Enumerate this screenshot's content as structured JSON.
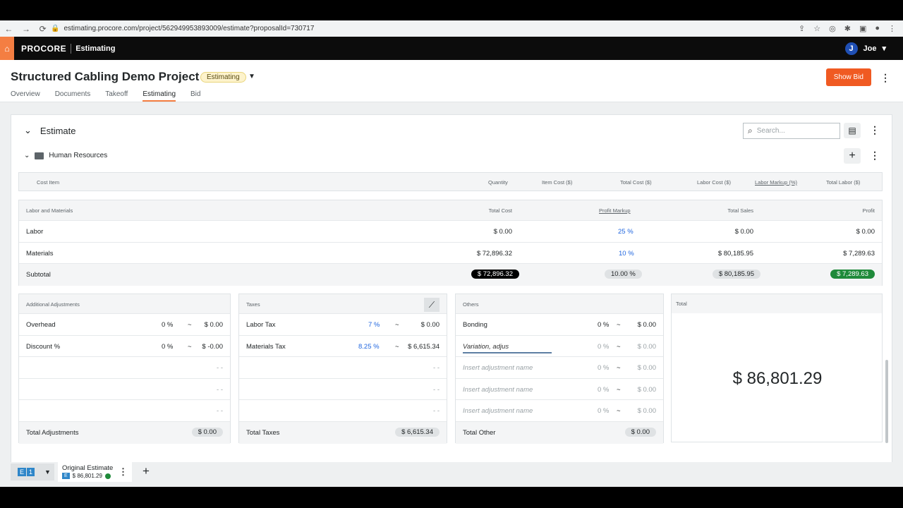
{
  "browser": {
    "url": "estimating.procore.com/project/562949953893009/estimate?proposalId=730717"
  },
  "appbar": {
    "logo": "PROCORE",
    "app_name": "Estimating",
    "user_initial": "J",
    "user_name": "Joe"
  },
  "project": {
    "title": "Structured Cabling Demo Project",
    "status": "Estimating",
    "show_bid": "Show Bid",
    "tabs": [
      "Overview",
      "Documents",
      "Takeoff",
      "Estimating",
      "Bid"
    ],
    "active_tab": "Estimating"
  },
  "estimate": {
    "title": "Estimate",
    "search_placeholder": "Search...",
    "group_name": "Human Resources",
    "cost_columns": [
      "Cost Item",
      "Quantity",
      "Item Cost ($)",
      "Total Cost ($)",
      "Labor Cost ($)",
      "Labor Markup (%)",
      "Total Labor ($)"
    ]
  },
  "labor_materials": {
    "headers": [
      "Labor and Materials",
      "Total Cost",
      "Profit Markup",
      "Total Sales",
      "Profit"
    ],
    "rows": [
      {
        "name": "Labor",
        "total_cost": "$ 0.00",
        "markup": "25 %",
        "total_sales": "$ 0.00",
        "profit": "$ 0.00"
      },
      {
        "name": "Materials",
        "total_cost": "$ 72,896.32",
        "markup": "10 %",
        "total_sales": "$ 80,185.95",
        "profit": "$ 7,289.63"
      }
    ],
    "subtotal": {
      "name": "Subtotal",
      "total_cost": "$ 72,896.32",
      "markup": "10.00 %",
      "total_sales": "$ 80,185.95",
      "profit": "$ 7,289.63"
    }
  },
  "adjustments": {
    "title": "Additional Adjustments",
    "rows": [
      {
        "name": "Overhead",
        "pct": "0 %",
        "sep": "~",
        "value": "$ 0.00"
      },
      {
        "name": "Discount %",
        "pct": "0 %",
        "sep": "~",
        "value": "$ -0.00"
      }
    ],
    "empty": "- -",
    "total_label": "Total Adjustments",
    "total": "$ 0.00"
  },
  "taxes": {
    "title": "Taxes",
    "rows": [
      {
        "name": "Labor Tax",
        "pct": "7 %",
        "sep": "~",
        "value": "$ 0.00"
      },
      {
        "name": "Materials Tax",
        "pct": "8.25 %",
        "sep": "~",
        "value": "$ 6,615.34"
      }
    ],
    "empty": "- -",
    "total_label": "Total Taxes",
    "total": "$ 6,615.34"
  },
  "others": {
    "title": "Others",
    "rows": [
      {
        "name": "Bonding",
        "pct": "0 %",
        "sep": "~",
        "value": "$ 0.00"
      },
      {
        "name": "Variation, adjus",
        "pct": "0 %",
        "sep": "~",
        "value": "$ 0.00"
      },
      {
        "name": "Insert adjustment name",
        "pct": "0 %",
        "sep": "~",
        "value": "$ 0.00"
      },
      {
        "name": "Insert adjustment name",
        "pct": "0 %",
        "sep": "~",
        "value": "$ 0.00"
      },
      {
        "name": "Insert adjustment name",
        "pct": "0 %",
        "sep": "~",
        "value": "$ 0.00"
      }
    ],
    "total_label": "Total Other",
    "total": "$ 0.00"
  },
  "total": {
    "title": "Total",
    "value": "$ 86,801.29"
  },
  "footer": {
    "badge_e": "E",
    "badge_num": "1",
    "estimate_name": "Original Estimate",
    "estimate_value": "$ 86,801.29"
  }
}
